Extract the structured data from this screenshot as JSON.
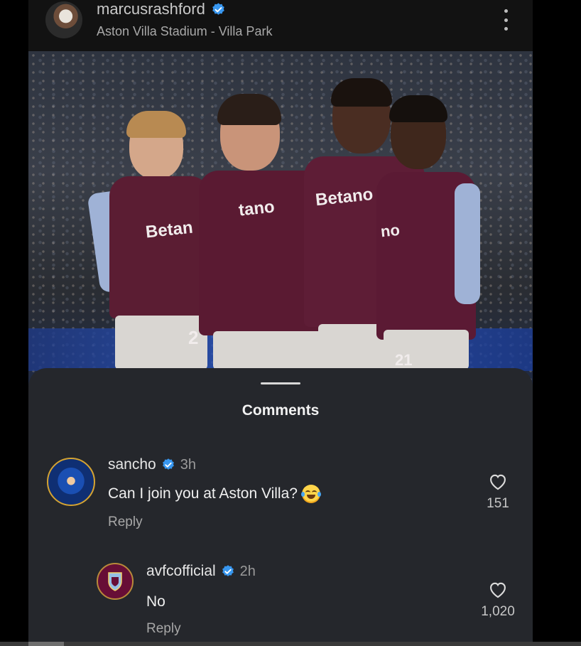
{
  "post": {
    "username": "marcusrashford",
    "location": "Aston Villa Stadium - Villa Park",
    "photo_text": {
      "sponsor_left": "Betan",
      "sponsor_middle": "tano",
      "sponsor_right": "Betano",
      "sponsor_far_right": "no",
      "number_left": "2",
      "number_right": "21"
    }
  },
  "comments_sheet": {
    "title": "Comments",
    "comments": [
      {
        "username": "sancho",
        "time": "3h",
        "text": "Can I join you at Aston Villa?",
        "emoji": "face-with-tears-of-joy",
        "reply_label": "Reply",
        "likes": "151"
      },
      {
        "username": "avfcofficial",
        "time": "2h",
        "text": "No",
        "reply_label": "Reply",
        "likes": "1,020"
      }
    ]
  },
  "colors": {
    "verified_blue": "#3897f0",
    "sheet_bg": "#25272c",
    "villa_claret": "#670e36",
    "villa_sky": "#95bfe5"
  }
}
